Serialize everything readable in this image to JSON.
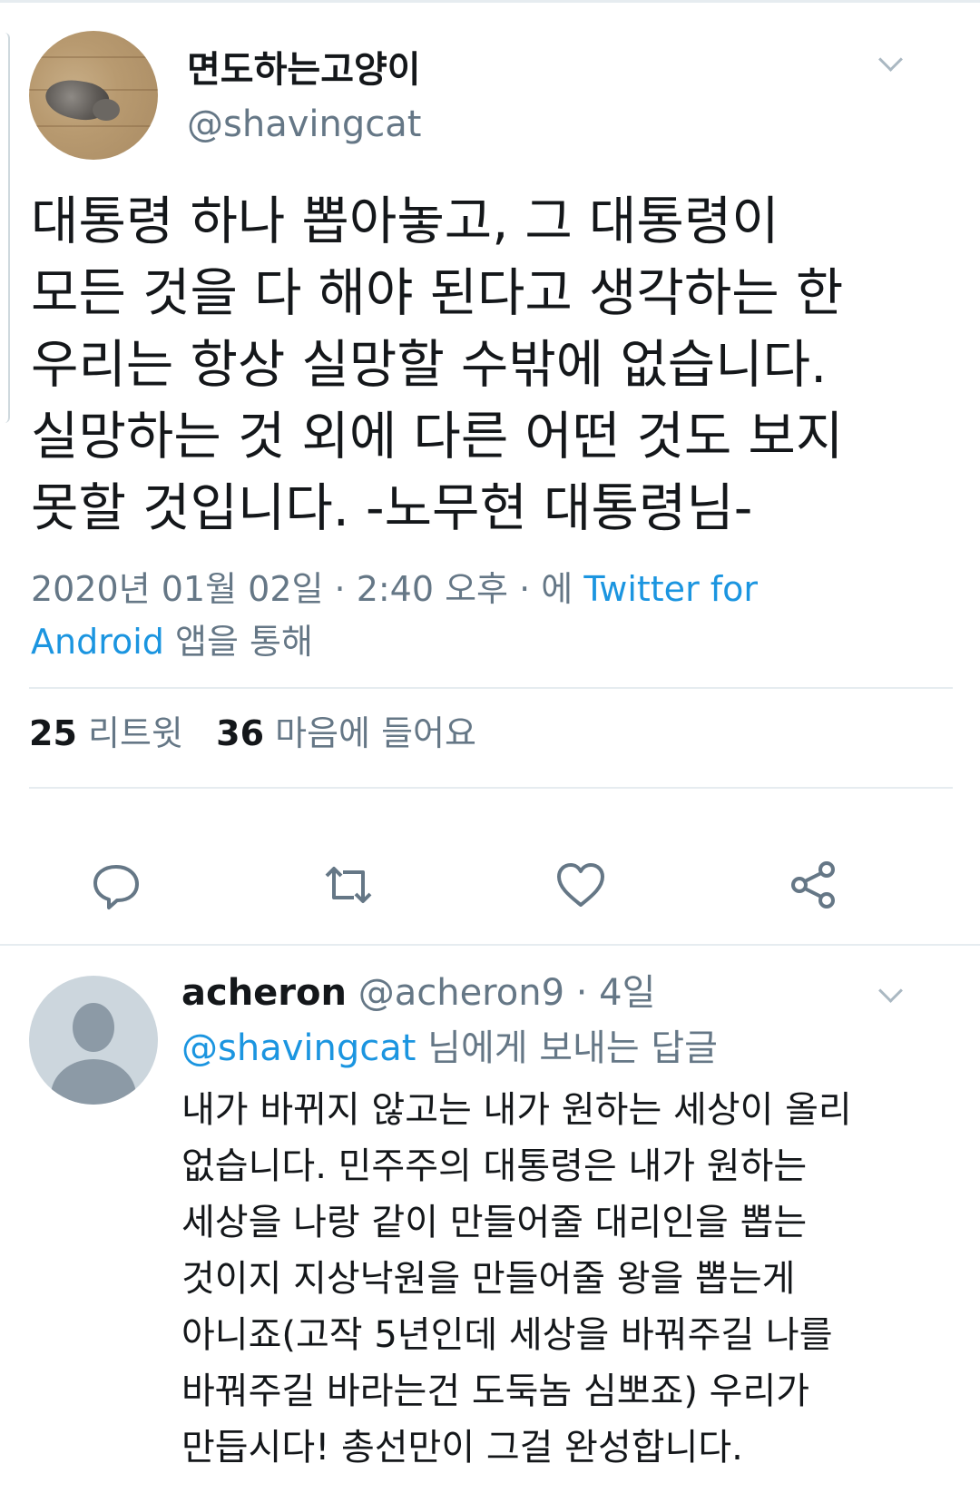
{
  "tweet": {
    "display_name": "면도하는고양이",
    "handle": "@shavingcat",
    "text_lines": [
      "대통령 하나 뽑아놓고, 그 대통령이",
      "모든 것을 다 해야 된다고 생각하는 한",
      "우리는 항상 실망할 수밖에 없습니다.",
      "실망하는 것 외에 다른 어떤 것도 보지",
      "못할 것입니다.  -노무현 대통령님-"
    ],
    "timestamp": "2020년 01월 02일 · 2:40 오후 · 에",
    "source_part1": "Twitter for",
    "source_part2": "Android",
    "via_suffix": "앱을 통해",
    "retweet_count": "25",
    "retweet_label": "리트윗",
    "like_count": "36",
    "like_label": "마음에 들어요"
  },
  "actions": {
    "reply_icon": "reply-icon",
    "retweet_icon": "retweet-icon",
    "like_icon": "heart-icon",
    "share_icon": "share-icon"
  },
  "reply": {
    "display_name": "acheron",
    "handle": "@acheron9",
    "time": "· 4일",
    "replying_to_handle": "@shavingcat",
    "replying_suffix": "님에게 보내는 답글",
    "text_lines": [
      "내가 바뀌지 않고는 내가 원하는 세상이 올리",
      "없습니다. 민주주의 대통령은 내가 원하는",
      "세상을 나랑 같이 만들어줄 대리인을 뽑는",
      "것이지 지상낙원을 만들어줄 왕을 뽑는게",
      "아니죠(고작 5년인데 세상을 바꿔주길 나를",
      "바꿔주길 바라는건 도둑놈 심뽀죠) 우리가",
      "만듭시다! 총선만이 그걸 완성합니다."
    ]
  },
  "colors": {
    "link": "#1b95e0",
    "secondary_text": "#657786",
    "primary_text": "#14171a",
    "divider": "#e6ecf0"
  }
}
